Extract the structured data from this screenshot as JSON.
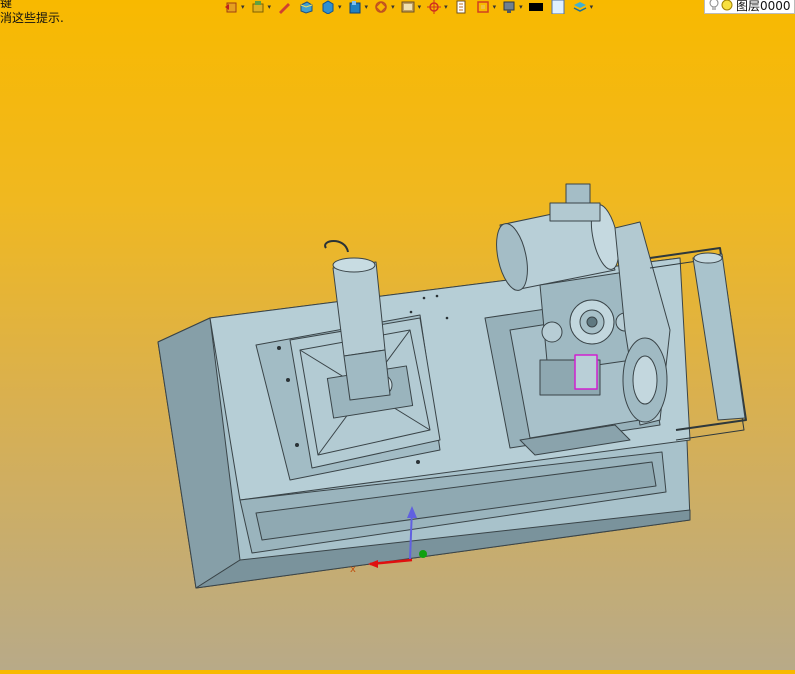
{
  "hints": {
    "line1": "键",
    "line2": "消这些提示."
  },
  "toolbar": {
    "items": [
      "undo-icon",
      "brush-icon",
      "pencil-icon",
      "solid-icon",
      "cube-icon",
      "box-icon",
      "rotate-icon",
      "view-icon",
      "target-icon",
      "page-icon",
      "frame-icon",
      "display-icon",
      "color-swatch-icon",
      "white-swatch-icon",
      "layers-icon"
    ]
  },
  "layer": {
    "label": "图层0000",
    "icons": [
      "bulb-icon",
      "circle-icon"
    ]
  },
  "colors": {
    "background_top": "#f8b900",
    "background_bottom": "#b8aa88",
    "model": "#a9c3cc",
    "model_dark": "#7d9aa4",
    "accent_magenta": "#d020d0",
    "axis_x": "#e01010",
    "axis_y": "#10a010",
    "axis_z": "#6060e0"
  }
}
